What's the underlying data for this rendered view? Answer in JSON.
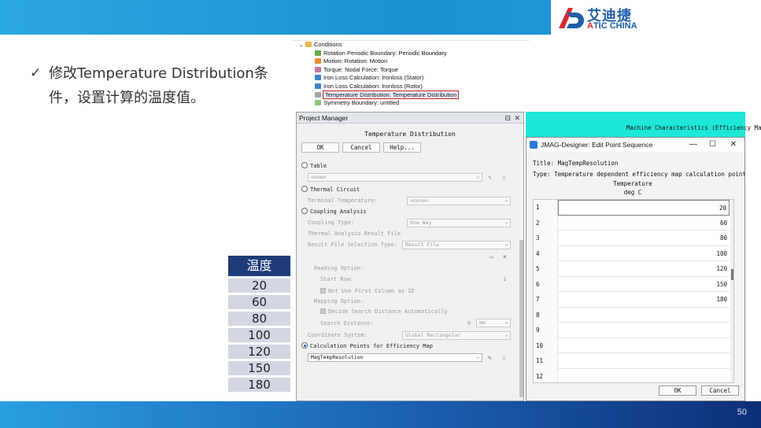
{
  "header": {
    "logo_cn": "艾迪捷",
    "logo_en_prefix": "A",
    "logo_en_rest": "TIC CHINA"
  },
  "bullet": {
    "check": "✓",
    "text": "修改Temperature Distribution条件，设置计算的温度值。"
  },
  "temperature_table": {
    "header": "温度",
    "values": [
      "20",
      "60",
      "80",
      "100",
      "120",
      "150",
      "180"
    ]
  },
  "tree": {
    "parent": "Conditions",
    "items": [
      "Rotation Periodic Boundary: Periodic Boundary",
      "Motion: Rotation: Motion",
      "Torque: Nodal Force: Torque",
      "Iron Loss Calculation: Ironloss (Stator)",
      "Iron Loss Calculation: Ironloss (Rotor)",
      "Temperature Distribution: Temperature Distribution",
      "Symmetry Boundary: untitled"
    ],
    "selected_index": 5,
    "colors": {
      "selection_outline": "#d0202a"
    }
  },
  "project_manager": {
    "title": "Project Manager",
    "subtitle": "Temperature Distribution",
    "ok": "OK",
    "cancel": "Cancel",
    "help": "Help...",
    "table_label": "Table",
    "table_value": "<new>",
    "thermal_circuit": "Thermal Circuit",
    "terminal_temp_label": "Terminal Temperature:",
    "terminal_temp_value": "<none>",
    "coupling_analysis": "Coupling Analysis",
    "coupling_type_label": "Coupling Type:",
    "coupling_type_value": "One Way",
    "thermal_result_file": "Thermal Analysis Result File",
    "result_file_sel_label": "Result File Selection Type:",
    "result_file_sel_value": "Result File",
    "reading_option": "Reading Option:",
    "start_row_label": "Start Row:",
    "start_row_value": "1",
    "not_use_first_col": "Not Use First Column as ID",
    "mapping_option": "Mapping Option:",
    "decide_search": "Decide Search Distance Automatically",
    "search_distance_label": "Search Distance:",
    "search_distance_value": "0",
    "search_distance_unit": "mm",
    "coord_system_label": "Coordinate System:",
    "coord_system_value": "Global Rectangular",
    "calc_points_label": "Calculation Points for Efficiency Map",
    "calc_points_value": "MagTempResolution"
  },
  "machine_characteristics": {
    "title": "Machine Characteristics (Efficiency Ma"
  },
  "dialog": {
    "title": "JMAG-Designer: Edit Point Sequence",
    "title_label": "Title:",
    "title_value": "MagTempResolution",
    "type_label": "Type:",
    "type_value": "Temperature dependent efficiency map calculation points",
    "col_header": "Temperature",
    "col_unit": "deg C",
    "rows": [
      {
        "idx": "1",
        "val": "20"
      },
      {
        "idx": "2",
        "val": "60"
      },
      {
        "idx": "3",
        "val": "80"
      },
      {
        "idx": "4",
        "val": "100"
      },
      {
        "idx": "5",
        "val": "120"
      },
      {
        "idx": "6",
        "val": "150"
      },
      {
        "idx": "7",
        "val": "180"
      },
      {
        "idx": "8",
        "val": ""
      },
      {
        "idx": "9",
        "val": ""
      },
      {
        "idx": "10",
        "val": ""
      },
      {
        "idx": "11",
        "val": ""
      },
      {
        "idx": "12",
        "val": ""
      }
    ],
    "ok": "OK",
    "cancel": "Cancel",
    "minimize": "—",
    "maximize": "☐",
    "close": "✕"
  },
  "footer": {
    "page": "50"
  },
  "colors": {
    "top_bar": "#2aa8e0",
    "bottom_bar_end": "#0e2f78",
    "table_header": "#1f3c7a",
    "table_cell": "#d3d7e3",
    "machine_strip": "#1ee7d8"
  }
}
